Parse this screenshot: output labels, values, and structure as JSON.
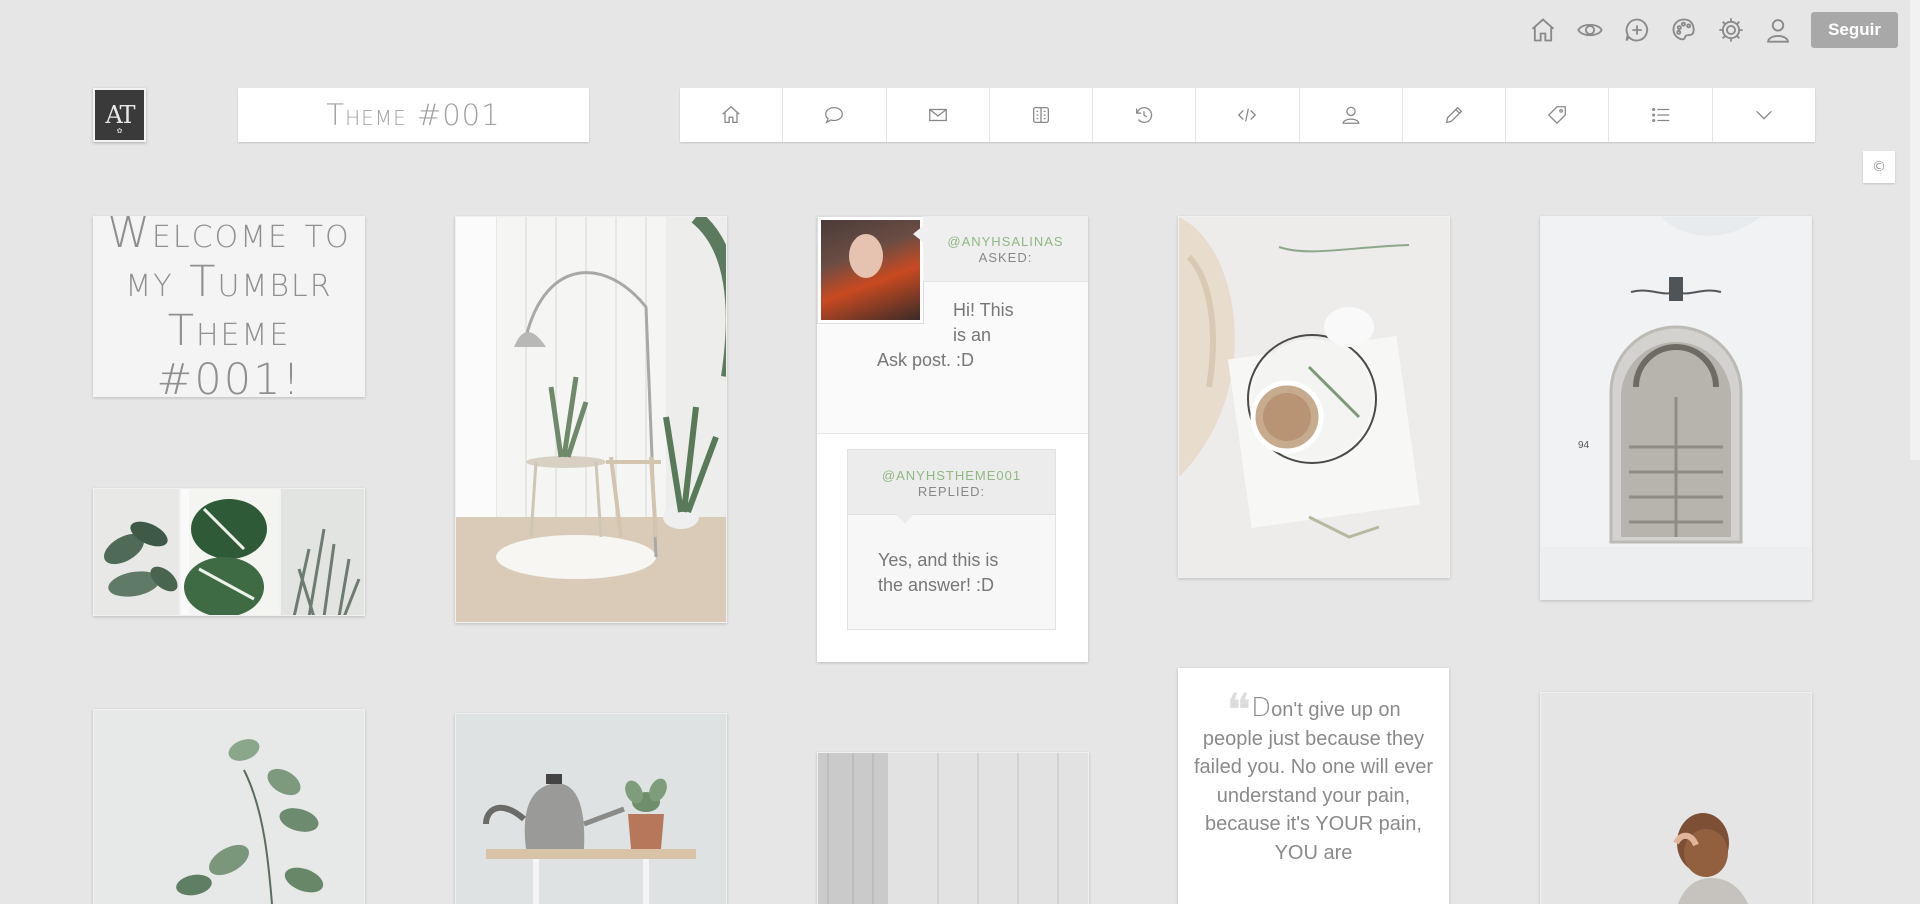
{
  "controls": {
    "icons": [
      "home-icon",
      "eye-icon",
      "plus-chat-icon",
      "palette-icon",
      "gear-icon",
      "user-icon"
    ],
    "follow_label": "Seguir"
  },
  "header": {
    "avatar_initials": "AT",
    "title": "Theme #001"
  },
  "nav": {
    "items": [
      {
        "icon": "home-icon"
      },
      {
        "icon": "speech-bubble-icon"
      },
      {
        "icon": "envelope-icon"
      },
      {
        "icon": "archive-icon"
      },
      {
        "icon": "history-icon"
      },
      {
        "icon": "code-icon"
      },
      {
        "icon": "user-icon"
      },
      {
        "icon": "pencil-icon"
      },
      {
        "icon": "tag-icon"
      },
      {
        "icon": "list-icon"
      },
      {
        "icon": "chevron-down-icon"
      }
    ]
  },
  "copyright_symbol": "©",
  "posts": {
    "welcome_text": "Welcome to my Tumblr Theme #001!",
    "ask": {
      "asker": "@ANYHSALINAS",
      "asked_label": "ASKED:",
      "question": "Hi! This is an Ask post. :D",
      "question_line1": "Hi! This",
      "question_line2": "is an",
      "question_line3": "Ask post. :D",
      "replier": "@ANYHSTHEME001",
      "replied_label": "REPLIED:",
      "answer": "Yes, and this is the answer! :D"
    },
    "quote": {
      "first_letter": "D",
      "text": "on't give up on people just because they failed you. No one will ever understand your pain, because it's YOUR pain, YOU are"
    }
  },
  "colors": {
    "background": "#e6e6e6",
    "accent_green": "#8fb882",
    "follow_button": "#a8a8a8"
  }
}
